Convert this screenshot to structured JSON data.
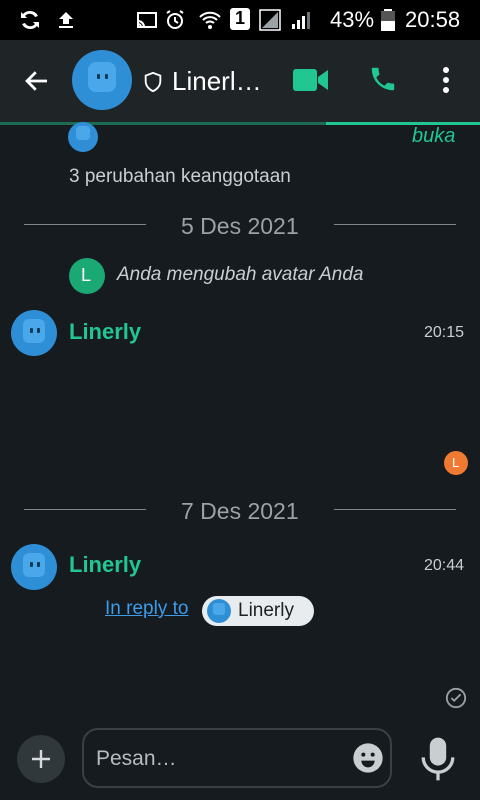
{
  "status_bar": {
    "battery_percent": "43%",
    "time": "20:58",
    "sim_slot": "1"
  },
  "toolbar": {
    "title": "Linerl…",
    "back_icon": "back-arrow-icon",
    "video_icon": "video-call-icon",
    "call_icon": "phone-call-icon",
    "more_icon": "more-vertical-icon"
  },
  "chat": {
    "top_link": "buka",
    "membership_changes": "3 perubahan keanggotaan",
    "date1": "5 Des 2021",
    "avatar_change_initial": "L",
    "avatar_change_text": "Anda mengubah avatar Anda",
    "msg1": {
      "sender": "Linerly",
      "time": "20:15"
    },
    "read_marker_initial": "L",
    "date2": "7 Des 2021",
    "msg2": {
      "sender": "Linerly",
      "time": "20:44",
      "reply_label": "In reply to",
      "reply_pill": "Linerly"
    }
  },
  "composer": {
    "placeholder": "Pesan…"
  },
  "colors": {
    "accent": "#22c690",
    "background": "#151b1f",
    "toolbar": "#1f2427",
    "link": "#3d9be9",
    "read_marker": "#f07a32"
  }
}
